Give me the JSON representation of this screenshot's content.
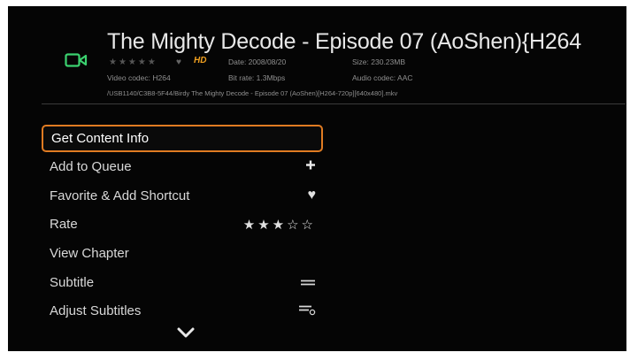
{
  "header": {
    "title": "The Mighty Decode - Episode 07 (AoShen){H264",
    "rating_stars": "★★★★★",
    "hd_badge": "HD",
    "date": "Date: 2008/08/20",
    "size": "Size: 230.23MB",
    "video_codec": "Video codec: H264",
    "bit_rate": "Bit rate: 1.3Mbps",
    "audio_codec": "Audio codec: AAC",
    "path": "/USB1140/C3B8-5F44/Birdy The Mighty Decode - Episode 07 (AoShen)[H264-720p][640x480].mkv"
  },
  "menu": {
    "items": [
      {
        "label": "Get Content Info",
        "icon": ""
      },
      {
        "label": "Add to Queue",
        "icon": "plus-icon"
      },
      {
        "label": "Favorite & Add Shortcut",
        "icon": "heart-icon"
      },
      {
        "label": "Rate",
        "icon": "rating-stars",
        "value": "★★★☆☆"
      },
      {
        "label": "View Chapter",
        "icon": ""
      },
      {
        "label": "Subtitle",
        "icon": "subtitle-icon"
      },
      {
        "label": "Adjust Subtitles",
        "icon": "adjust-subtitle-icon"
      }
    ],
    "selected_index": 0
  },
  "colors": {
    "accent": "#e07b22",
    "video_icon": "#3bd16f",
    "hd": "#f0a020",
    "background": "#050505"
  }
}
